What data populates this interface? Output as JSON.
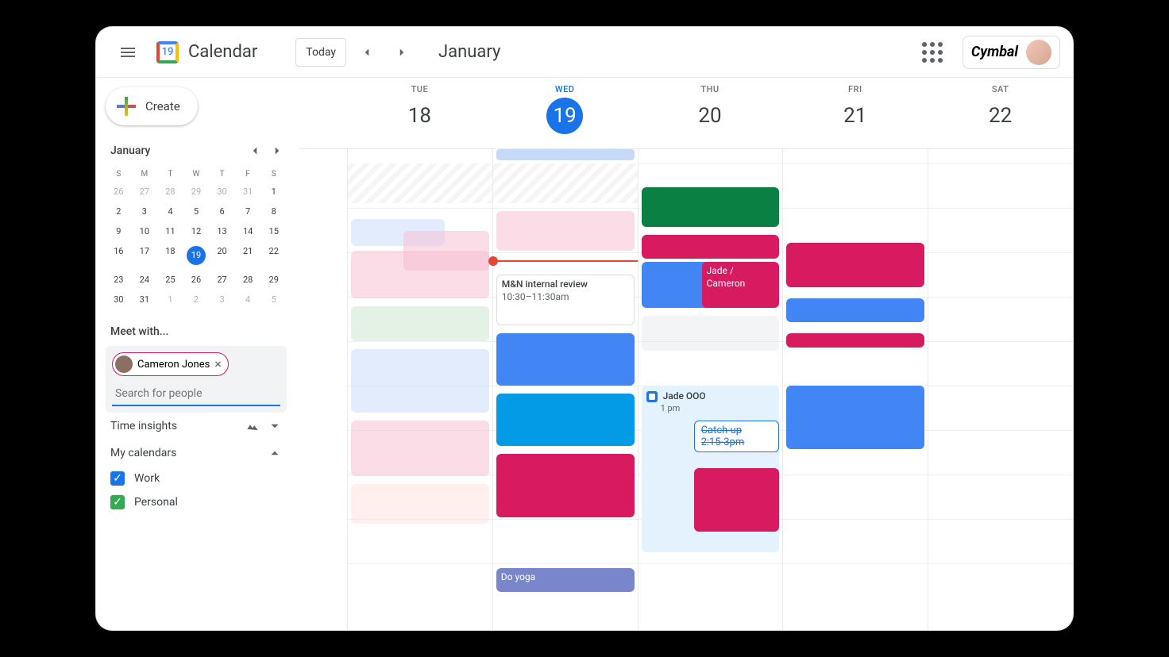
{
  "header": {
    "app_title": "Calendar",
    "logo_day": "19",
    "today_label": "Today",
    "month_title": "January",
    "org_name": "Cymbal"
  },
  "sidebar": {
    "create_label": "Create",
    "mini_month": "January",
    "dow": [
      "S",
      "M",
      "T",
      "W",
      "T",
      "F",
      "S"
    ],
    "weeks": [
      [
        {
          "d": "26",
          "f": true
        },
        {
          "d": "27",
          "f": true
        },
        {
          "d": "28",
          "f": true
        },
        {
          "d": "29",
          "f": true
        },
        {
          "d": "30",
          "f": true
        },
        {
          "d": "31",
          "f": true
        },
        {
          "d": "1"
        }
      ],
      [
        {
          "d": "2"
        },
        {
          "d": "3"
        },
        {
          "d": "4"
        },
        {
          "d": "5"
        },
        {
          "d": "6"
        },
        {
          "d": "7"
        },
        {
          "d": "8"
        }
      ],
      [
        {
          "d": "9"
        },
        {
          "d": "10"
        },
        {
          "d": "11"
        },
        {
          "d": "12"
        },
        {
          "d": "13"
        },
        {
          "d": "14"
        },
        {
          "d": "15"
        }
      ],
      [
        {
          "d": "16"
        },
        {
          "d": "17"
        },
        {
          "d": "18"
        },
        {
          "d": "19",
          "today": true
        },
        {
          "d": "20"
        },
        {
          "d": "21"
        },
        {
          "d": "22"
        }
      ],
      [
        {
          "d": "23"
        },
        {
          "d": "24"
        },
        {
          "d": "25"
        },
        {
          "d": "26"
        },
        {
          "d": "27"
        },
        {
          "d": "28"
        },
        {
          "d": "29"
        }
      ],
      [
        {
          "d": "30"
        },
        {
          "d": "31"
        },
        {
          "d": "1",
          "f": true
        },
        {
          "d": "2",
          "f": true
        },
        {
          "d": "3",
          "f": true
        },
        {
          "d": "4",
          "f": true
        },
        {
          "d": "5",
          "f": true
        }
      ]
    ],
    "meet_with_label": "Meet with...",
    "chip_name": "Cameron Jones",
    "search_placeholder": "Search for people",
    "time_insights_label": "Time insights",
    "my_calendars_label": "My calendars",
    "calendars": [
      {
        "name": "Work",
        "color": "blue"
      },
      {
        "name": "Personal",
        "color": "green"
      }
    ]
  },
  "days": [
    {
      "dow": "TUE",
      "num": "18"
    },
    {
      "dow": "WED",
      "num": "19",
      "active": true
    },
    {
      "dow": "THU",
      "num": "20"
    },
    {
      "dow": "FRI",
      "num": "21"
    },
    {
      "dow": "SAT",
      "num": "22"
    }
  ],
  "events": {
    "review_title": "M&N internal review",
    "review_time": "10:30–11:30am",
    "jade_cameron": "Jade / Cameron",
    "jade_ooo": "Jade OOO",
    "jade_ooo_time": "1 pm",
    "catchup": "Catch up",
    "catchup_time": "2:15-3pm",
    "do_yoga": "Do yoga"
  }
}
